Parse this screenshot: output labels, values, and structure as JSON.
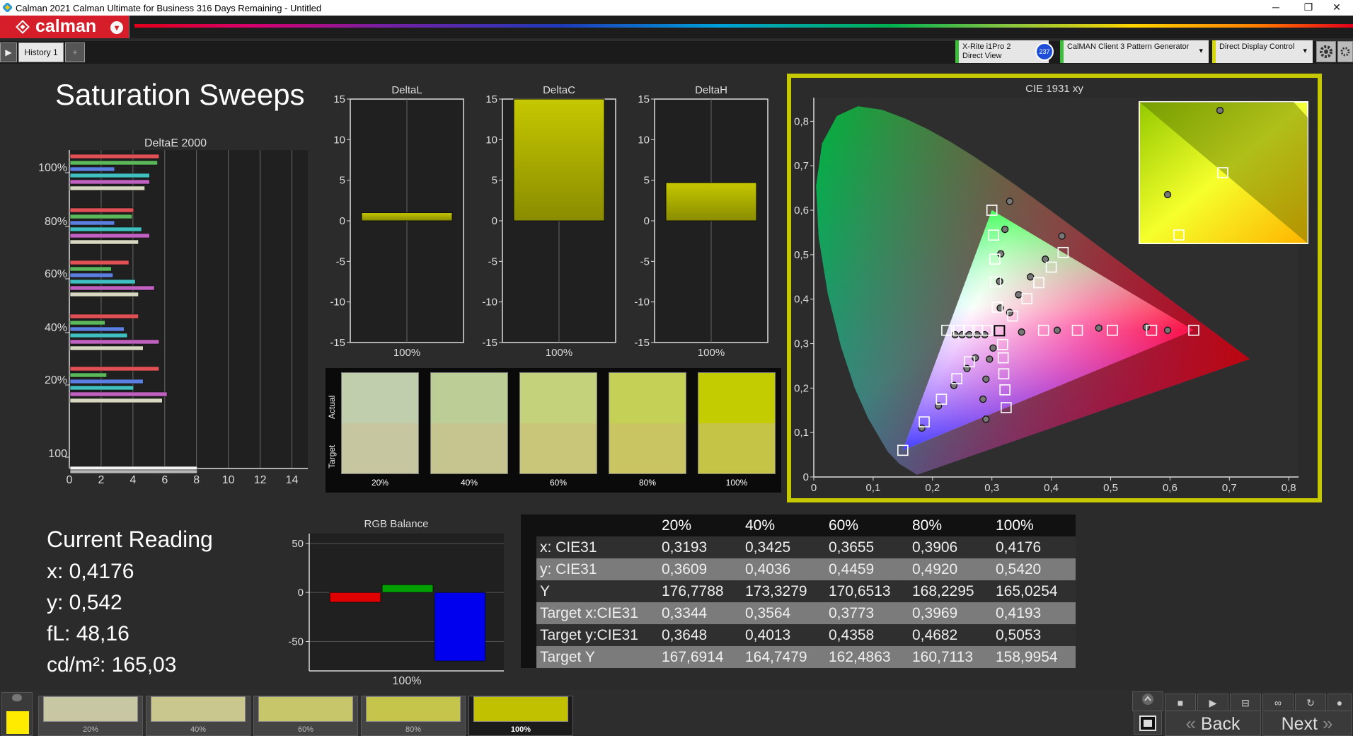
{
  "window": {
    "title": "Calman 2021 Calman Ultimate for Business 316 Days Remaining  - Untitled",
    "minimize": "─",
    "restore": "❐",
    "close": "✕"
  },
  "app": {
    "logo_text": "calman",
    "logo_dropdown": "▾"
  },
  "tabs": {
    "history_label": "History 1",
    "add_label": "+",
    "nav_arrow": "▶"
  },
  "devices": {
    "meter_line1": "X-Rite i1Pro 2",
    "meter_line2": "Direct View",
    "meter_badge": "237",
    "generator_label": "CalMAN Client 3 Pattern Generator",
    "display_label": "Direct Display Control",
    "arrow": "▾",
    "settings_icon": "gear-icon"
  },
  "page_title": "Saturation Sweeps",
  "deltaE": {
    "title": "DeltaE 2000",
    "groups": [
      "100%",
      "80%",
      "60%",
      "40%",
      "20%",
      "100"
    ],
    "xticks": [
      "0",
      "2",
      "4",
      "6",
      "8",
      "10",
      "12",
      "14"
    ]
  },
  "delta_charts": [
    {
      "title": "DeltaL",
      "value_label": "100%"
    },
    {
      "title": "DeltaC",
      "value_label": "100%"
    },
    {
      "title": "DeltaH",
      "value_label": "100%"
    }
  ],
  "delta_ticks": [
    "15",
    "10",
    "5",
    "0",
    "-5",
    "-10",
    "-15"
  ],
  "swatch_panel": {
    "actual_label": "Actual",
    "target_label": "Target",
    "swatches": [
      {
        "label": "20%",
        "actual": "#c1ceae",
        "target": "#c6c6a0"
      },
      {
        "label": "40%",
        "actual": "#bccd96",
        "target": "#c6c48f"
      },
      {
        "label": "60%",
        "actual": "#c5d27c",
        "target": "#c9c679"
      },
      {
        "label": "80%",
        "actual": "#c4d056",
        "target": "#c8c562"
      },
      {
        "label": "100%",
        "actual": "#c2cc00",
        "target": "#c6c447"
      }
    ]
  },
  "cie": {
    "title": "CIE 1931 xy",
    "xticks": [
      "0",
      "0,1",
      "0,2",
      "0,3",
      "0,4",
      "0,5",
      "0,6",
      "0,7",
      "0,8"
    ],
    "yticks": [
      "0",
      "0,1",
      "0,2",
      "0,3",
      "0,4",
      "0,5",
      "0,6",
      "0,7",
      "0,8"
    ]
  },
  "rgb_balance": {
    "title": "RGB Balance",
    "yticks": [
      "50",
      "0",
      "-50"
    ],
    "xlabel": "100%"
  },
  "current_reading": {
    "heading": "Current Reading",
    "x": "x: 0,4176",
    "y": "y: 0,542",
    "fL": "fL: 48,16",
    "cdm2": "cd/m²: 165,03"
  },
  "table": {
    "columns": [
      "20%",
      "40%",
      "60%",
      "80%",
      "100%"
    ],
    "rows": [
      {
        "label": "x: CIE31",
        "values": [
          "0,3193",
          "0,3425",
          "0,3655",
          "0,3906",
          "0,4176"
        ]
      },
      {
        "label": "y: CIE31",
        "values": [
          "0,3609",
          "0,4036",
          "0,4459",
          "0,4920",
          "0,5420"
        ]
      },
      {
        "label": "Y",
        "values": [
          "176,7788",
          "173,3279",
          "170,6513",
          "168,2295",
          "165,0254"
        ]
      },
      {
        "label": "Target x:CIE31",
        "values": [
          "0,3344",
          "0,3564",
          "0,3773",
          "0,3969",
          "0,4193"
        ]
      },
      {
        "label": "Target y:CIE31",
        "values": [
          "0,3648",
          "0,4013",
          "0,4358",
          "0,4682",
          "0,5053"
        ]
      },
      {
        "label": "Target Y",
        "values": [
          "167,6914",
          "164,7479",
          "162,4863",
          "160,7113",
          "158,9954"
        ]
      }
    ]
  },
  "bottom": {
    "swatches": [
      {
        "label": "20%",
        "color": "#c8c7a3"
      },
      {
        "label": "40%",
        "color": "#c9c78e"
      },
      {
        "label": "60%",
        "color": "#c7c66b"
      },
      {
        "label": "80%",
        "color": "#c6c54b"
      },
      {
        "label": "100%",
        "color": "#c1c100"
      }
    ],
    "back_label": "Back",
    "next_label": "Next",
    "back_arrow": "«",
    "next_arrow": "»"
  },
  "chart_data": [
    {
      "type": "bar",
      "title": "DeltaE 2000",
      "orientation": "horizontal",
      "xlim": [
        0,
        15
      ],
      "categories": [
        "100%",
        "80%",
        "60%",
        "40%",
        "20%",
        "100"
      ],
      "series": [
        {
          "values": [
            5.6,
            4.0,
            3.7,
            4.3,
            5.6,
            8.0
          ]
        },
        {
          "values": [
            5.5,
            3.9,
            2.6,
            2.2,
            2.3,
            8.0
          ]
        },
        {
          "values": [
            2.8,
            2.8,
            2.7,
            3.4,
            4.6,
            null
          ]
        },
        {
          "values": [
            5.0,
            4.5,
            4.1,
            3.6,
            4.0,
            null
          ]
        },
        {
          "values": [
            5.0,
            5.0,
            5.3,
            5.6,
            6.1,
            null
          ]
        },
        {
          "values": [
            4.7,
            4.3,
            4.3,
            4.6,
            5.8,
            null
          ]
        }
      ],
      "colors": [
        "#e05055",
        "#5bb85b",
        "#5b7fe0",
        "#3fbfbf",
        "#c060c0",
        "#d8d8c0"
      ]
    },
    {
      "type": "bar",
      "title": "DeltaL",
      "categories": [
        "100%"
      ],
      "values": [
        1.0
      ],
      "ylim": [
        -15,
        15
      ]
    },
    {
      "type": "bar",
      "title": "DeltaC",
      "categories": [
        "100%"
      ],
      "values": [
        15
      ],
      "ylim": [
        -15,
        15
      ]
    },
    {
      "type": "bar",
      "title": "DeltaH",
      "categories": [
        "100%"
      ],
      "values": [
        4.7
      ],
      "ylim": [
        -15,
        15
      ]
    },
    {
      "type": "scatter",
      "title": "CIE 1931 xy",
      "xlim": [
        0,
        0.8
      ],
      "ylim": [
        0,
        0.85
      ],
      "gamut": {
        "red": [
          0.64,
          0.33
        ],
        "green": [
          0.3,
          0.6
        ],
        "blue": [
          0.15,
          0.06
        ],
        "white": [
          0.3127,
          0.329
        ]
      },
      "targets": [
        [
          0.3,
          0.6
        ],
        [
          0.303,
          0.544
        ],
        [
          0.305,
          0.49
        ],
        [
          0.306,
          0.439
        ],
        [
          0.309,
          0.382
        ],
        [
          0.42,
          0.505
        ],
        [
          0.4,
          0.472
        ],
        [
          0.379,
          0.437
        ],
        [
          0.359,
          0.401
        ],
        [
          0.335,
          0.362
        ],
        [
          0.64,
          0.33
        ],
        [
          0.569,
          0.33
        ],
        [
          0.503,
          0.33
        ],
        [
          0.444,
          0.33
        ],
        [
          0.387,
          0.33
        ],
        [
          0.324,
          0.156
        ],
        [
          0.322,
          0.196
        ],
        [
          0.32,
          0.232
        ],
        [
          0.319,
          0.268
        ],
        [
          0.318,
          0.298
        ],
        [
          0.15,
          0.06
        ],
        [
          0.186,
          0.124
        ],
        [
          0.215,
          0.175
        ],
        [
          0.241,
          0.221
        ],
        [
          0.262,
          0.259
        ],
        [
          0.224,
          0.33
        ],
        [
          0.244,
          0.33
        ],
        [
          0.262,
          0.33
        ],
        [
          0.276,
          0.33
        ],
        [
          0.292,
          0.33
        ]
      ],
      "measured": [
        [
          0.33,
          0.62
        ],
        [
          0.322,
          0.557
        ],
        [
          0.315,
          0.502
        ],
        [
          0.313,
          0.44
        ],
        [
          0.314,
          0.38
        ],
        [
          0.418,
          0.542
        ],
        [
          0.39,
          0.49
        ],
        [
          0.365,
          0.45
        ],
        [
          0.345,
          0.41
        ],
        [
          0.33,
          0.37
        ],
        [
          0.596,
          0.33
        ],
        [
          0.56,
          0.337
        ],
        [
          0.48,
          0.335
        ],
        [
          0.41,
          0.33
        ],
        [
          0.35,
          0.326
        ],
        [
          0.29,
          0.13
        ],
        [
          0.285,
          0.175
        ],
        [
          0.29,
          0.22
        ],
        [
          0.296,
          0.265
        ],
        [
          0.302,
          0.29
        ],
        [
          0.182,
          0.11
        ],
        [
          0.21,
          0.16
        ],
        [
          0.236,
          0.206
        ],
        [
          0.258,
          0.244
        ],
        [
          0.272,
          0.268
        ],
        [
          0.238,
          0.32
        ],
        [
          0.25,
          0.32
        ],
        [
          0.262,
          0.32
        ],
        [
          0.275,
          0.32
        ],
        [
          0.288,
          0.32
        ]
      ]
    },
    {
      "type": "bar",
      "title": "RGB Balance",
      "categories": [
        "100%"
      ],
      "series": [
        {
          "name": "R",
          "values": [
            -10
          ]
        },
        {
          "name": "G",
          "values": [
            8
          ]
        },
        {
          "name": "B",
          "values": [
            -70
          ]
        }
      ],
      "ylim": [
        -80,
        60
      ]
    }
  ]
}
